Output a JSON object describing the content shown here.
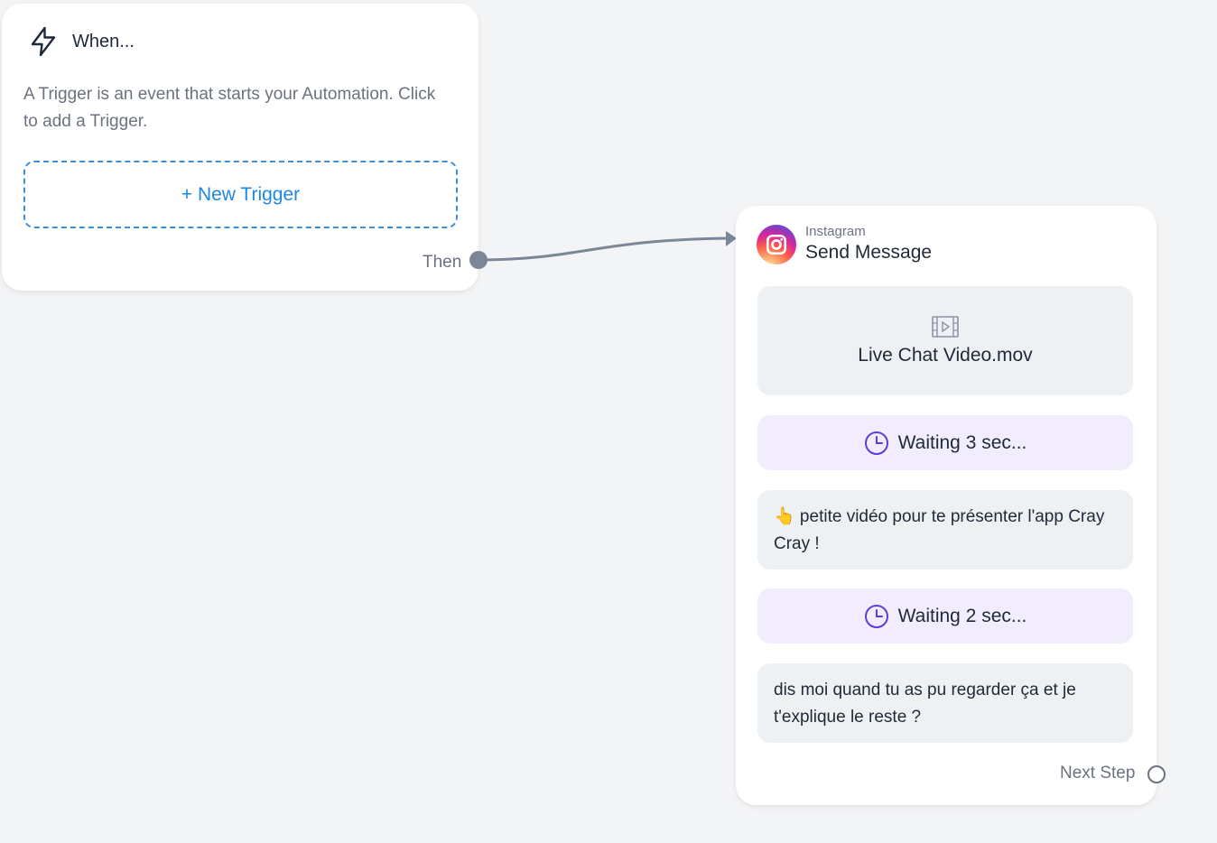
{
  "trigger": {
    "title": "When...",
    "description": "A Trigger is an event that starts your Automation. Click to add a Trigger.",
    "new_trigger_label": "+ New Trigger",
    "then_label": "Then",
    "icon": "lightning-bolt-icon"
  },
  "action": {
    "platform": "Instagram",
    "title": "Send Message",
    "icon": "instagram-icon",
    "video": {
      "icon": "film-icon",
      "filename": "Live Chat Video.mov"
    },
    "wait_1": {
      "icon": "clock-icon",
      "label": "Waiting 3 sec..."
    },
    "message_1": "👆 petite vidéo pour te présenter l'app Cray Cray !",
    "wait_2": {
      "icon": "clock-icon",
      "label": "Waiting 2 sec..."
    },
    "message_2": "dis moi quand tu as pu regarder ça et je t'explique le reste ?",
    "next_label": "Next Step"
  },
  "colors": {
    "canvas_bg": "#f3f4f6",
    "accent_blue": "#1e88e5",
    "wait_bg": "#f1edfd",
    "wait_icon": "#5b3fd1",
    "connector": "#7b8797"
  }
}
